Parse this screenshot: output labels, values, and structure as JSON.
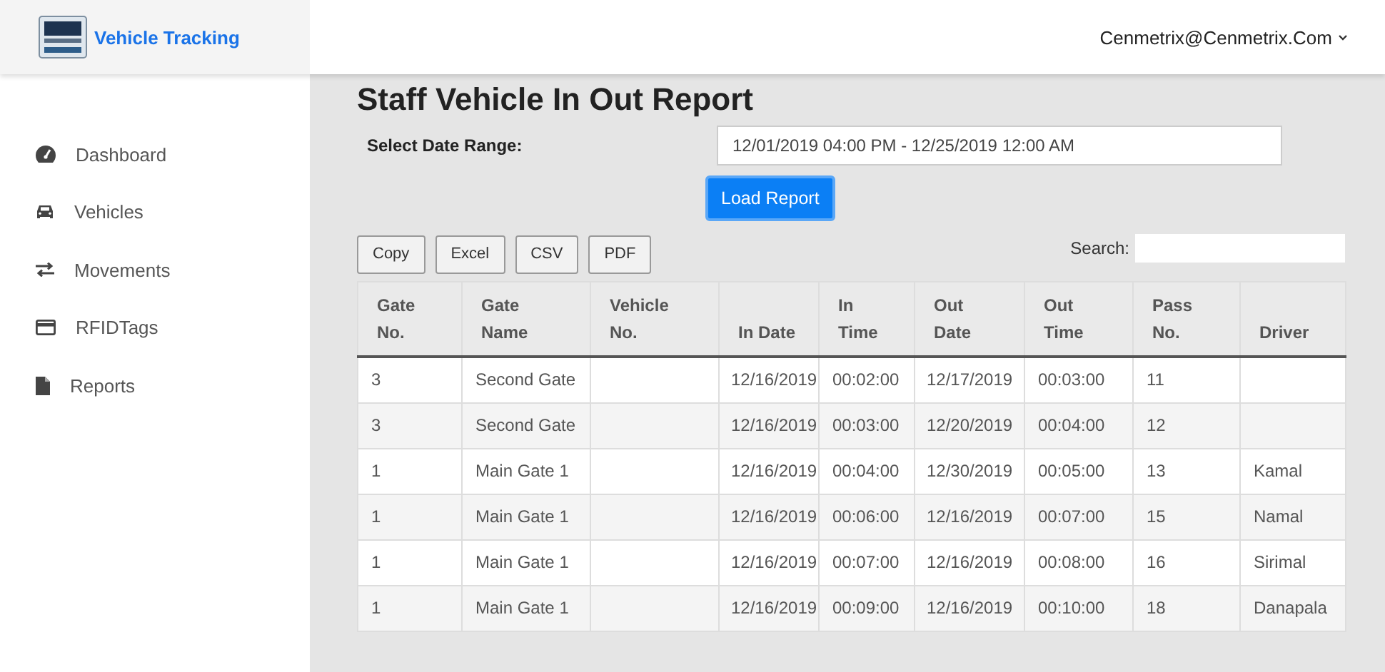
{
  "app": {
    "title": "Vehicle Tracking"
  },
  "header": {
    "user": "Cenmetrix@Cenmetrix.Com"
  },
  "sidebar": {
    "items": [
      {
        "label": "Dashboard",
        "kind": "dashboard"
      },
      {
        "label": "Vehicles",
        "kind": "vehicles"
      },
      {
        "label": "Movements",
        "kind": "movements"
      },
      {
        "label": "RFIDTags",
        "kind": "rfid"
      },
      {
        "label": "Reports",
        "kind": "reports"
      }
    ]
  },
  "page": {
    "title": "Staff Vehicle In Out Report",
    "date_label": "Select Date Range:",
    "date_value": "12/01/2019 04:00 PM - 12/25/2019 12:00 AM",
    "load_button": "Load Report"
  },
  "export_buttons": [
    "Copy",
    "Excel",
    "CSV",
    "PDF"
  ],
  "search": {
    "label": "Search:"
  },
  "table": {
    "columns": [
      {
        "lines": [
          "Gate",
          "No."
        ]
      },
      {
        "lines": [
          "Gate",
          "Name"
        ]
      },
      {
        "lines": [
          "Vehicle",
          "No."
        ]
      },
      {
        "lines": [
          "In Date"
        ]
      },
      {
        "lines": [
          "In",
          "Time"
        ]
      },
      {
        "lines": [
          "Out",
          "Date"
        ]
      },
      {
        "lines": [
          "Out",
          "Time"
        ]
      },
      {
        "lines": [
          "Pass",
          "No."
        ]
      },
      {
        "lines": [
          "Driver"
        ]
      }
    ],
    "rows": [
      [
        "3",
        "Second Gate",
        "",
        "12/16/2019",
        "00:02:00",
        "12/17/2019",
        "00:03:00",
        "11",
        ""
      ],
      [
        "3",
        "Second Gate",
        "",
        "12/16/2019",
        "00:03:00",
        "12/20/2019",
        "00:04:00",
        "12",
        ""
      ],
      [
        "1",
        "Main Gate 1",
        "",
        "12/16/2019",
        "00:04:00",
        "12/30/2019",
        "00:05:00",
        "13",
        "Kamal"
      ],
      [
        "1",
        "Main Gate 1",
        "",
        "12/16/2019",
        "00:06:00",
        "12/16/2019",
        "00:07:00",
        "15",
        "Namal"
      ],
      [
        "1",
        "Main Gate 1",
        "",
        "12/16/2019",
        "00:07:00",
        "12/16/2019",
        "00:08:00",
        "16",
        "Sirimal"
      ],
      [
        "1",
        "Main Gate 1",
        "",
        "12/16/2019",
        "00:09:00",
        "12/16/2019",
        "00:10:00",
        "18",
        "Danapala"
      ]
    ]
  }
}
